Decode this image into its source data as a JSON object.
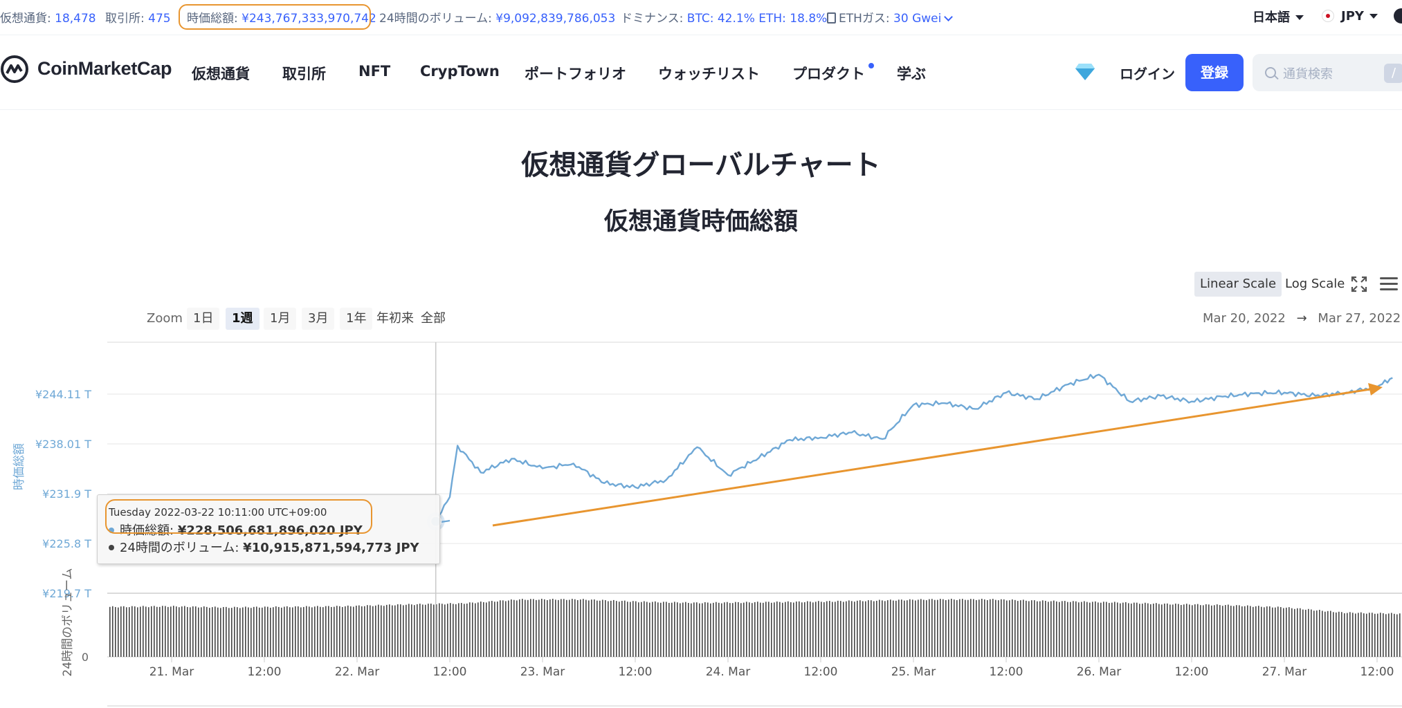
{
  "stats": {
    "cryptos_label": "仮想通貨:",
    "cryptos_value": "18,478",
    "exchanges_label": "取引所:",
    "exchanges_value": "475",
    "mcap_label": "時価総額:",
    "mcap_value": "¥243,767,333,970,742",
    "volume_label": "24時間のボリューム:",
    "volume_value": "¥9,092,839,786,053",
    "dominance_label": "ドミナンス:",
    "dominance_value": "BTC: 42.1% ETH: 18.8%",
    "gas_label": "ETHガス:",
    "gas_value": "30 Gwei",
    "language": "日本語",
    "currency": "JPY"
  },
  "nav": {
    "brand": "CoinMarketCap",
    "items": [
      "仮想通貨",
      "取引所",
      "NFT",
      "CrypTown",
      "ポートフォリオ",
      "ウォッチリスト",
      "プロダクト",
      "学ぶ"
    ],
    "login": "ログイン",
    "signup": "登録",
    "search_placeholder": "通貨検索",
    "search_shortcut": "/"
  },
  "page": {
    "title": "仮想通貨グローバルチャート",
    "subtitle": "仮想通貨時価総額"
  },
  "controls": {
    "linear_scale": "Linear Scale",
    "log_scale": "Log Scale",
    "zoom_label": "Zoom",
    "zoom_options": [
      "1日",
      "1週",
      "1月",
      "3月",
      "1年",
      "年初来",
      "全部"
    ],
    "zoom_selected": "1週",
    "range_from": "Mar 20, 2022",
    "range_arrow": "→",
    "range_to": "Mar 27, 2022"
  },
  "chart_data": {
    "type": "line",
    "y_axis_label": "時価総額",
    "volume_axis_label": "24時間のボリューム",
    "y_ticks": [
      "¥244.11 T",
      "¥238.01 T",
      "¥231.9 T",
      "¥225.8 T",
      "¥219.7 T"
    ],
    "y_tick_values": [
      244.11,
      238.01,
      231.9,
      225.8,
      219.7
    ],
    "volume_tick": "0",
    "x_ticks": [
      "21. Mar",
      "12:00",
      "22. Mar",
      "12:00",
      "23. Mar",
      "12:00",
      "24. Mar",
      "12:00",
      "25. Mar",
      "12:00",
      "26. Mar",
      "12:00",
      "27. Mar",
      "12:00"
    ],
    "x_tick_times": [
      "2022-03-21T00:00",
      "2022-03-21T12:00",
      "2022-03-22T00:00",
      "2022-03-22T12:00",
      "2022-03-23T00:00",
      "2022-03-23T12:00",
      "2022-03-24T00:00",
      "2022-03-24T12:00",
      "2022-03-25T00:00",
      "2022-03-25T12:00",
      "2022-03-26T00:00",
      "2022-03-26T12:00",
      "2022-03-27T00:00",
      "2022-03-27T12:00"
    ],
    "series": [
      {
        "name": "時価総額",
        "color": "#6fa8d6",
        "x": [
          "2022-03-22T10:11",
          "2022-03-22T12:00",
          "2022-03-22T13:00",
          "2022-03-22T16:00",
          "2022-03-22T20:00",
          "2022-03-23T00:00",
          "2022-03-23T04:00",
          "2022-03-23T08:00",
          "2022-03-23T12:00",
          "2022-03-23T16:00",
          "2022-03-23T20:00",
          "2022-03-24T00:00",
          "2022-03-24T04:00",
          "2022-03-24T08:00",
          "2022-03-24T12:00",
          "2022-03-24T16:00",
          "2022-03-24T20:00",
          "2022-03-25T00:00",
          "2022-03-25T04:00",
          "2022-03-25T08:00",
          "2022-03-25T12:00",
          "2022-03-25T16:00",
          "2022-03-25T20:00",
          "2022-03-26T00:00",
          "2022-03-26T04:00",
          "2022-03-26T08:00",
          "2022-03-26T12:00",
          "2022-03-26T16:00",
          "2022-03-26T20:00",
          "2022-03-27T00:00",
          "2022-03-27T04:00",
          "2022-03-27T08:00",
          "2022-03-27T12:00",
          "2022-03-27T14:00"
        ],
        "values": [
          228.51,
          231.5,
          237.8,
          234.5,
          236.2,
          235.0,
          235.6,
          233.2,
          232.7,
          233.6,
          237.6,
          234.2,
          236.3,
          238.5,
          238.8,
          239.4,
          238.6,
          242.8,
          243.0,
          242.3,
          244.3,
          243.5,
          245.3,
          246.5,
          243.2,
          243.9,
          243.2,
          243.8,
          244.2,
          244.3,
          243.9,
          244.3,
          245.0,
          246.1
        ]
      },
      {
        "name": "24時間のボリューム",
        "color": "#444444",
        "values_relative": [
          0.87,
          0.88,
          0.86,
          0.87,
          0.88,
          0.91,
          0.93,
          1.0,
          1.0,
          0.96,
          0.94,
          0.95,
          0.96,
          0.98,
          1.0,
          1.0,
          0.97,
          0.95,
          0.92,
          0.9,
          0.86,
          0.77,
          0.75
        ]
      }
    ],
    "annotation": "trend arrow (orange) rising to the right",
    "tooltip": {
      "date": "Tuesday 2022-03-22 10:11:00 UTC+09:00",
      "mcap_label": "時価総額:",
      "mcap_value": "¥228,506,681,896,020 JPY",
      "volume_label": "24時間のボリューム:",
      "volume_value": "¥10,915,871,594,773 JPY"
    }
  },
  "colors": {
    "accent": "#3861fb",
    "highlight": "#e8952f",
    "line": "#6fa8d6"
  }
}
